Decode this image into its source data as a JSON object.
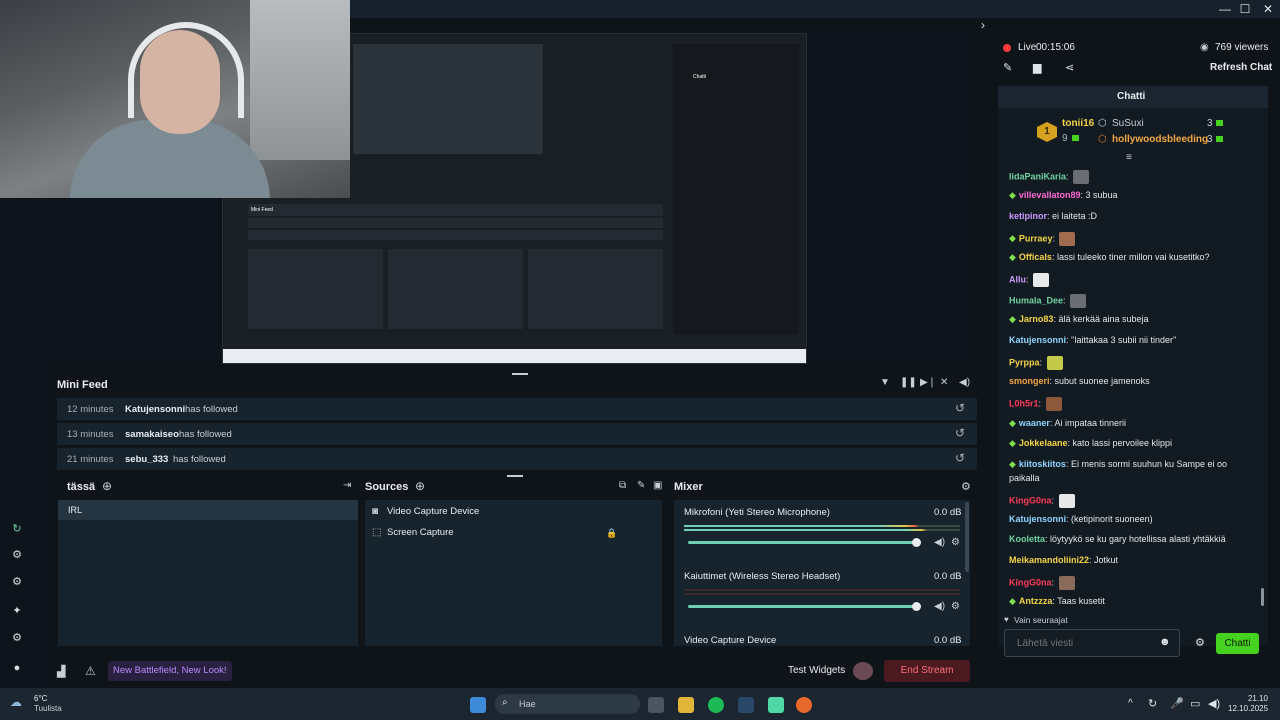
{
  "window": {
    "minimize": "—",
    "maximize": "☐",
    "close": "✕"
  },
  "stream": {
    "live_label": "Live",
    "live_time": "00:15:06",
    "viewers": "769 viewers",
    "refresh_chat": "Refresh Chat"
  },
  "chat": {
    "title": "Chatti",
    "leaderboard": {
      "rank": "1",
      "top_user": "tonii16",
      "top_count": "9",
      "second": {
        "name": "SuSuxi",
        "count": "3"
      },
      "third": {
        "name": "hollywoodsbleeding",
        "count": "3"
      }
    },
    "messages": [
      {
        "user": "IidaPaniKaria",
        "color": "#6fd3a2",
        "text": "",
        "sub": false,
        "emote": "#6b6f73"
      },
      {
        "user": "villevallaton89",
        "color": "#ff6ad5",
        "text": "3 subua",
        "sub": true
      },
      {
        "user": "ketipinor",
        "color": "#c89bff",
        "text": "ei laiteta :D",
        "sub": false
      },
      {
        "user": "Purraey",
        "color": "#f5d547",
        "text": "",
        "sub": true,
        "emote": "#a06b4f"
      },
      {
        "user": "Officals",
        "color": "#f5d547",
        "text": "lassi tuleeko tiner millon vai kusetitko?",
        "sub": true
      },
      {
        "user": "Allu",
        "color": "#c89bff",
        "text": "",
        "sub": false,
        "emote": "#e8e8e8"
      },
      {
        "user": "Humala_Dee",
        "color": "#6fd3a2",
        "text": "",
        "sub": false,
        "emote": "#6b6f73"
      },
      {
        "user": "Jarno83",
        "color": "#f5d547",
        "text": "älä kerkää aina subeja",
        "sub": true
      },
      {
        "user": "Katujensonni",
        "color": "#8fd5ff",
        "text": "''laittakaa 3 subii nii tinder''",
        "sub": false
      },
      {
        "user": "Pyrppa",
        "color": "#f5d547",
        "text": "",
        "sub": false,
        "emote": "#c5c94a"
      },
      {
        "user": "smongeri",
        "color": "#f5a742",
        "text": "subut suonee jamenoks",
        "sub": false
      },
      {
        "user": "L0h5r1",
        "color": "#ff3a5a",
        "text": "",
        "sub": false,
        "emote": "#8a5a3a"
      },
      {
        "user": "waaner",
        "color": "#8fd5ff",
        "text": "Ai impataa tinnerii",
        "sub": true
      },
      {
        "user": "Jokkelaane",
        "color": "#f5d547",
        "text": "kato lassi pervoilee klippi",
        "sub": true
      },
      {
        "user": "kiitoskiitos",
        "color": "#8fd5ff",
        "text": "Ei menis sormi suuhun ku Sampe ei oo",
        "text2": "paikalla",
        "sub": true
      },
      {
        "user": "KingG0na",
        "color": "#ff3a5a",
        "text": "",
        "sub": false,
        "emote": "#e8e8e8"
      },
      {
        "user": "Katujensonni",
        "color": "#8fd5ff",
        "text": "(ketipinorit suoneen)",
        "sub": false
      },
      {
        "user": "Kooletta",
        "color": "#6fd3a2",
        "text": "löytyykö se ku gary hotellissa alasti yhtäkkiä",
        "sub": false
      },
      {
        "user": "Meikamandoliini22",
        "color": "#f5d547",
        "text": "Jotkut",
        "sub": false
      },
      {
        "user": "KingG0na",
        "color": "#ff3a5a",
        "text": "",
        "sub": false,
        "emote": "#8a6a5a"
      },
      {
        "user": "Antzzza",
        "color": "#f5d547",
        "text": "Taas kusetit",
        "sub": true
      }
    ],
    "followers_only": "Vain seuraajat",
    "input_placeholder": "Lähetä viesti",
    "send_label": "Chatti"
  },
  "minifeed": {
    "title": "Mini Feed",
    "rows": [
      {
        "time": "12 minutes",
        "user": "Katujensonni",
        "action": "has followed"
      },
      {
        "time": "13 minutes",
        "user": "samakaiseo",
        "action": "has followed"
      },
      {
        "time": "21 minutes",
        "user": "sebu_333",
        "action": "has followed"
      }
    ]
  },
  "scenes": {
    "title": "tässä",
    "items": [
      "IRL"
    ]
  },
  "sources": {
    "title": "Sources",
    "items": [
      "Video Capture Device",
      "Screen Capture"
    ]
  },
  "mixer": {
    "title": "Mixer",
    "channels": [
      {
        "name": "Mikrofoni (Yeti Stereo Microphone)",
        "db": "0.0 dB"
      },
      {
        "name": "Kaiuttimet (Wireless Stereo Headset)",
        "db": "0.0 dB"
      },
      {
        "name": "Video Capture Device",
        "db": "0.0 dB"
      }
    ]
  },
  "footer": {
    "promo": "New Battlefield, New Look!",
    "test_widgets": "Test Widgets",
    "end_stream": "End Stream"
  },
  "taskbar": {
    "weather_temp": "6°C",
    "weather_desc": "Tuulista",
    "search_placeholder": "Hae",
    "time": "21.10",
    "date": "12.10.2025"
  },
  "colors": {
    "accent_green": "#46d31f",
    "live_red": "#ff3b3b",
    "end_stream_bg": "#4a1a20"
  }
}
